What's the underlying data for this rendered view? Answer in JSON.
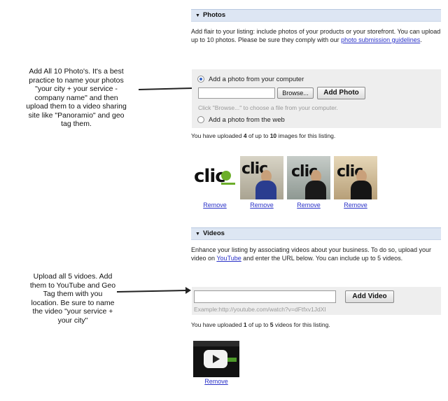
{
  "annotations": {
    "photos_note": [
      "Add All 10 Photo's. It's a best",
      "practice to name your photos",
      "\"your city + your service -",
      "company name\" and then",
      "upload them to a video sharing",
      "site like \"Panoramio\" and geo",
      "tag them."
    ],
    "videos_note": [
      "Upload all 5 vidoes. Add",
      "them to YouTube and Geo",
      "Tag them with you",
      "location. Be sure to name",
      "the video \"your service +",
      "your city\""
    ]
  },
  "photos": {
    "header": "Photos",
    "description_before_link": "Add flair to your listing: include photos of your products or your storefront. You can upload up to 10 photos. Please be sure they comply with our",
    "description_link": "photo submission guidelines",
    "description_after_link": ".",
    "option_computer": "Add a photo from your computer",
    "browse_label": "Browse...",
    "add_photo_label": "Add Photo",
    "hint": "Click \"Browse...\" to choose a file from your computer.",
    "option_web": "Add a photo from the web",
    "count_prefix": "You have uploaded",
    "count_value": "4",
    "count_middle": "of up to",
    "count_max": "10",
    "count_suffix": "images for this listing.",
    "thumb_logo_text": "clic",
    "remove_label": "Remove"
  },
  "videos": {
    "header": "Videos",
    "description_before_link": "Enhance your listing by associating videos about your business. To do so, upload your video on",
    "description_link": "YouTube",
    "description_after_link": "and enter the URL below. You can include up to 5 videos.",
    "url_value": "",
    "add_video_label": "Add Video",
    "example": "Example:http://youtube.com/watch?v=dFtfxv1JdXI",
    "count_prefix": "You have uploaded",
    "count_value": "1",
    "count_middle": "of up to",
    "count_max": "5",
    "count_suffix": "videos for this listing.",
    "remove_label": "Remove"
  },
  "colors": {
    "section_header_bg": "#dde6f3",
    "link": "#2a32c8",
    "panel_bg": "#eeeeee",
    "hint_text": "#9a9a9a",
    "radio_selected": "#3a67c4"
  },
  "icons": {
    "section_toggle": "triangle-down-icon",
    "video_play": "play-icon",
    "annotation_arrow": "arrow-right-icon"
  }
}
